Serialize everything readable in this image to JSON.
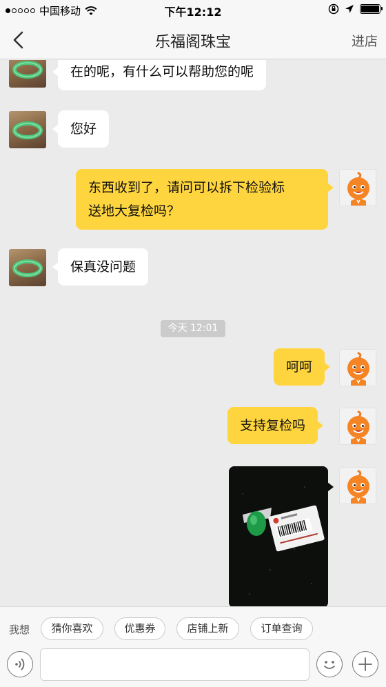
{
  "status": {
    "carrier": "中国移动",
    "time": "下午12:12"
  },
  "nav": {
    "title": "乐福阁珠宝",
    "enter_store": "进店"
  },
  "messages": [
    {
      "from": "shop",
      "text": "在的呢，有什么可以帮助您的呢"
    },
    {
      "from": "shop",
      "text": "您好"
    },
    {
      "from": "me",
      "lines": [
        "东西收到了，请问可以拆下检验标",
        "送地大复检吗？"
      ]
    },
    {
      "from": "shop",
      "text": "保真没问题"
    },
    {
      "type": "timestamp",
      "text": "今天 12:01"
    },
    {
      "from": "me",
      "text": "呵呵"
    },
    {
      "from": "me",
      "text": "支持复检吗"
    },
    {
      "from": "me",
      "type": "image",
      "label": "检验证书"
    }
  ],
  "quick": {
    "label": "我想",
    "chips": [
      "猜你喜欢",
      "优惠券",
      "店铺上新",
      "订单查询"
    ]
  },
  "icons": {
    "voice": "voice-icon",
    "emoji": "smiley-icon",
    "plus": "plus-icon",
    "back": "chevron-left-icon"
  },
  "colors": {
    "out_bubble": "#fed53e",
    "in_bubble": "#ffffff",
    "background": "#ebebeb"
  }
}
